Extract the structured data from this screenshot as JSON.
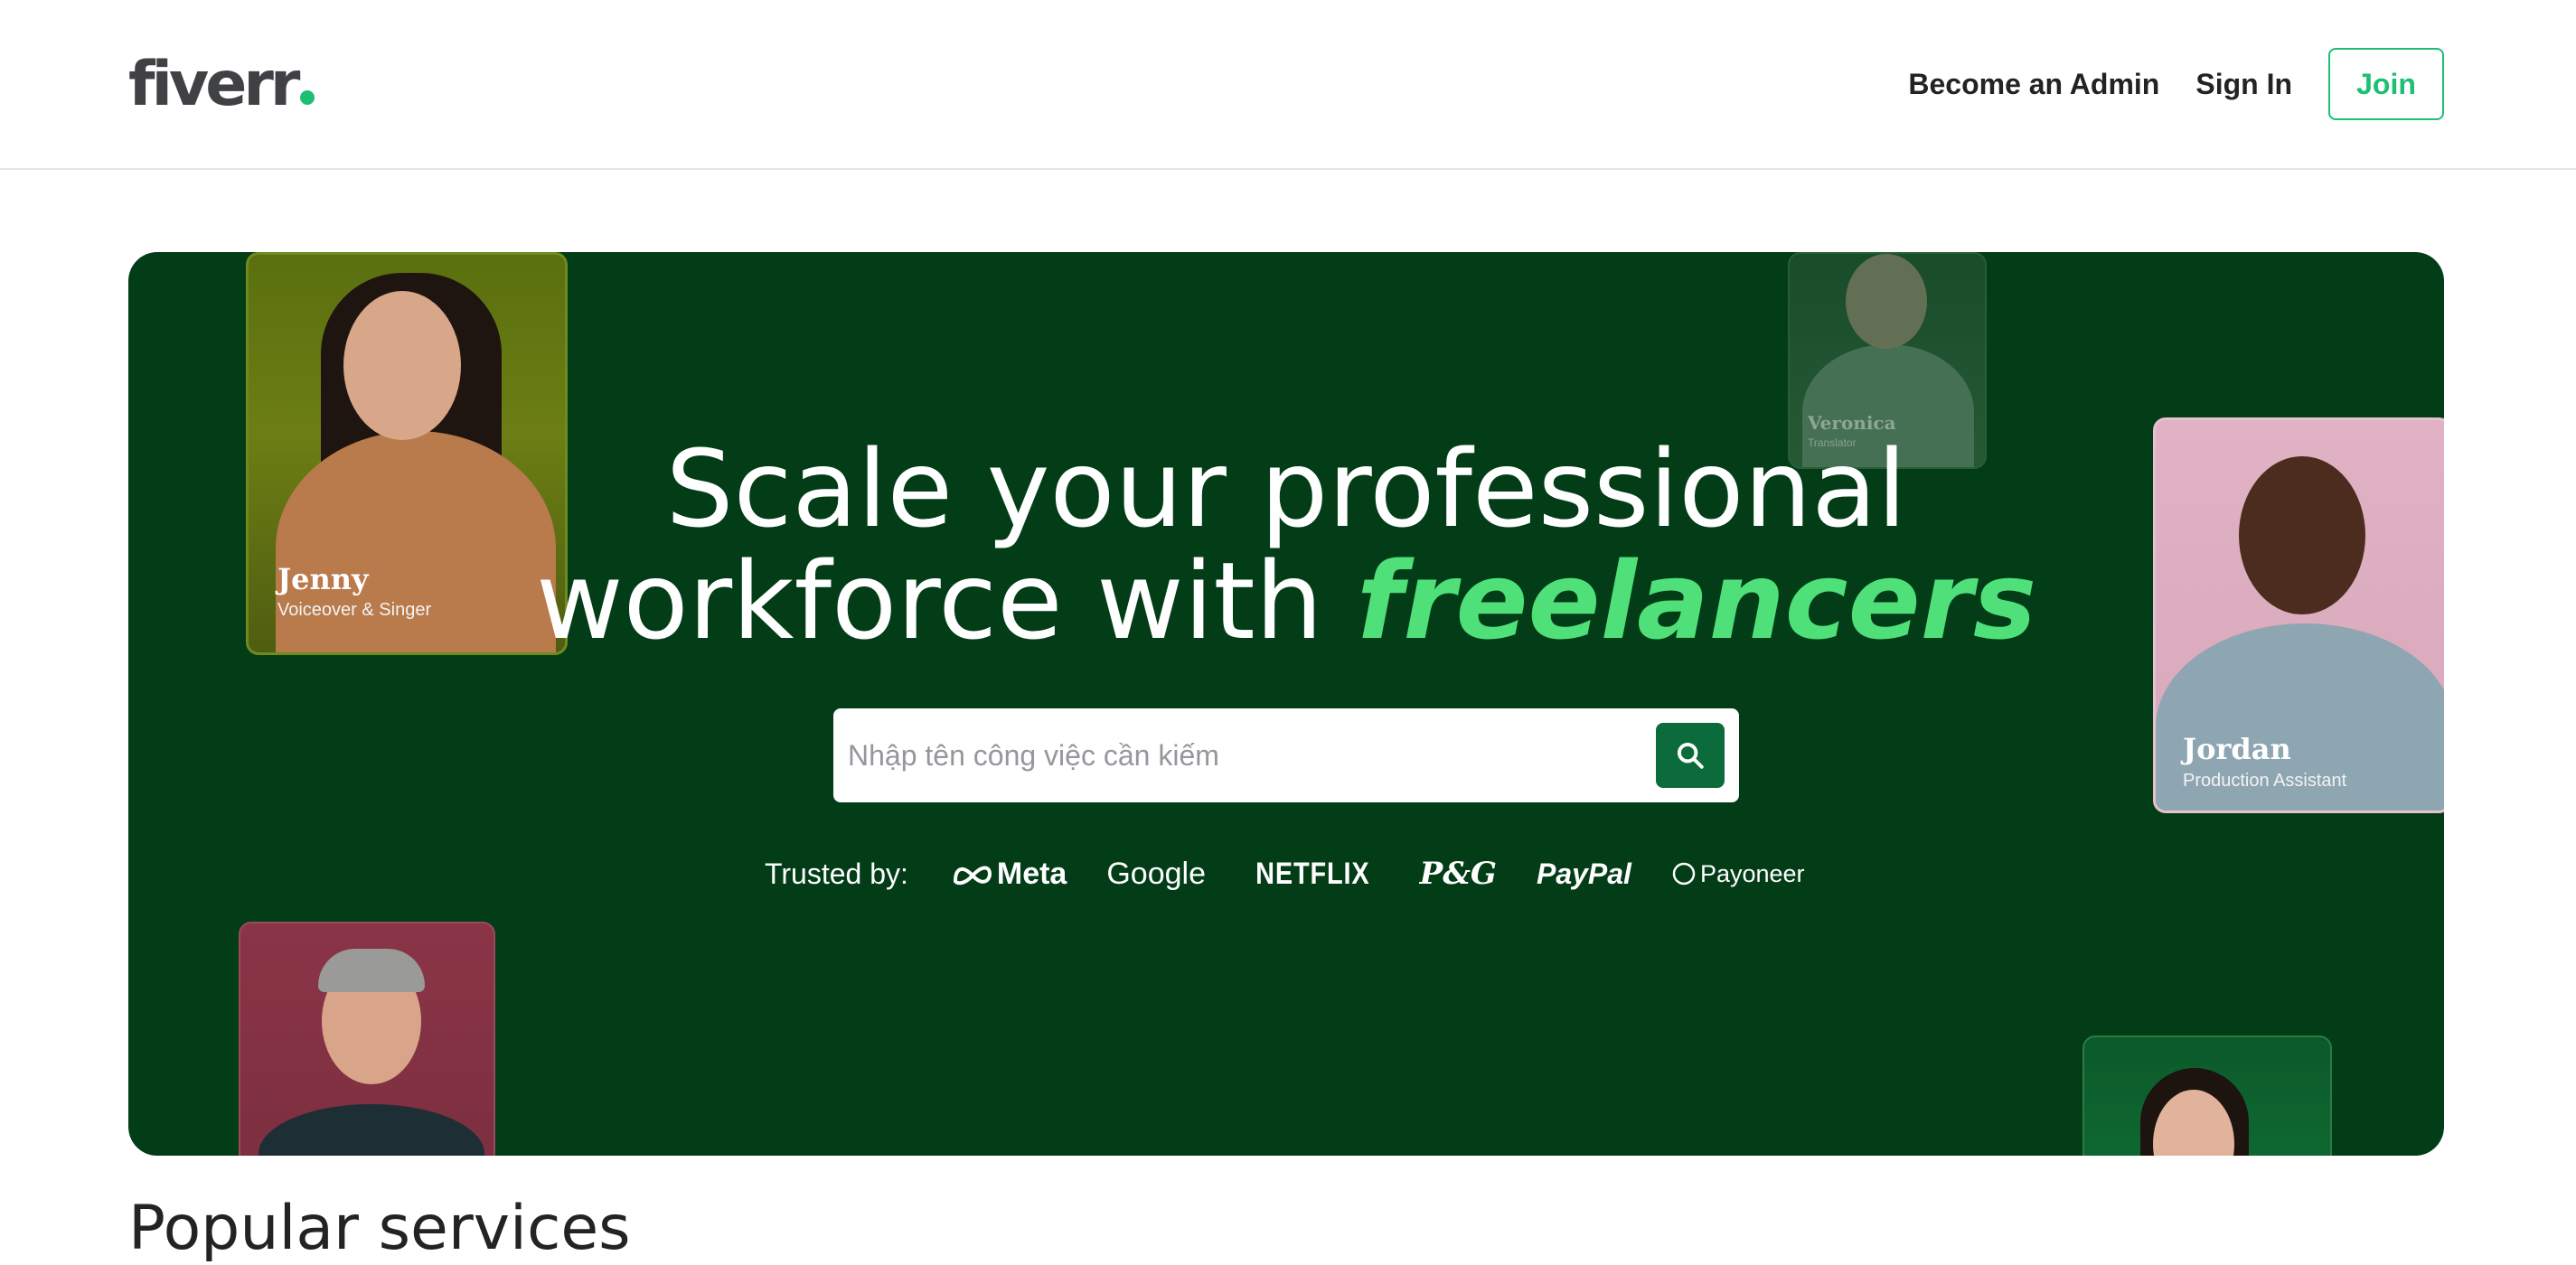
{
  "header": {
    "logo_text": "fiverr",
    "nav": {
      "become_admin": "Become an Admin",
      "sign_in": "Sign In",
      "join": "Join"
    }
  },
  "hero": {
    "title_line1": "Scale your professional",
    "title_line2_prefix": "workforce with ",
    "title_line2_accent": "freelancers",
    "search": {
      "placeholder": "Nhập tên công việc cần kiếm",
      "value": ""
    },
    "trusted_label": "Trusted by:",
    "brands": [
      "Meta",
      "Google",
      "NETFLIX",
      "P&G",
      "PayPal",
      "Payoneer"
    ],
    "cards": {
      "jenny": {
        "name": "Jenny",
        "role": "Voiceover & Singer"
      },
      "veronica": {
        "name": "Veronica",
        "role": "Translator"
      },
      "jordan": {
        "name": "Jordan",
        "role": "Production Assistant"
      }
    }
  },
  "sections": {
    "popular_services_title": "Popular services"
  },
  "colors": {
    "brand_green": "#1dbf73",
    "hero_bg": "#023d17",
    "accent_text": "#4fe07a",
    "search_button": "#0b6b3a"
  }
}
